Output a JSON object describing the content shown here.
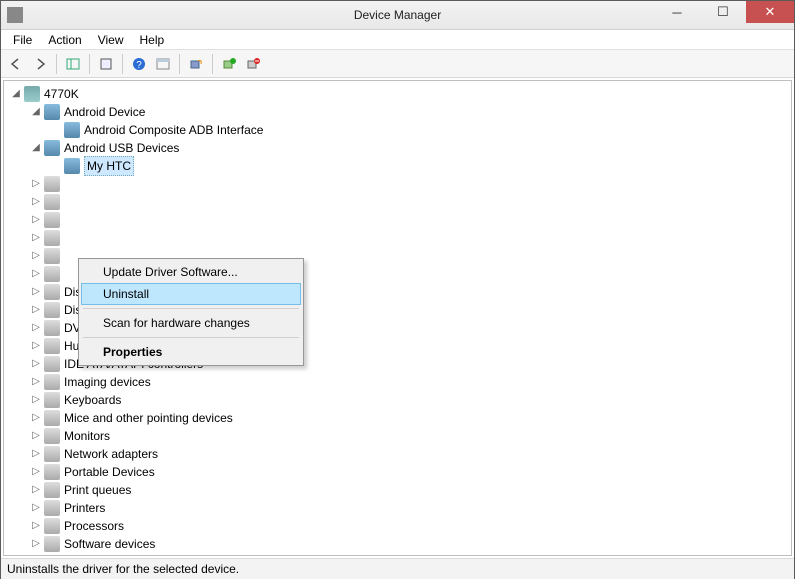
{
  "window": {
    "title": "Device Manager"
  },
  "menus": {
    "file": "File",
    "action": "Action",
    "view": "View",
    "help": "Help"
  },
  "toolbar_icons": {
    "back": "←",
    "forward": "→",
    "show_hide": "□",
    "properties": "□",
    "help": "?",
    "action_menu": "□",
    "scan": "⟳",
    "update": "+",
    "uninstall": "×"
  },
  "tree": {
    "root": "4770K",
    "android_device": "Android Device",
    "android_adb": "Android Composite ADB Interface",
    "android_usb": "Android USB Devices",
    "my_htc": "My HTC",
    "collapsed": [
      "Disk drives",
      "Display adapters",
      "DVD/CD-ROM drives",
      "Human Interface Devices",
      "IDE ATA/ATAPI controllers",
      "Imaging devices",
      "Keyboards",
      "Mice and other pointing devices",
      "Monitors",
      "Network adapters",
      "Portable Devices",
      "Print queues",
      "Printers",
      "Processors",
      "Software devices"
    ],
    "blank_collapsed_above": 4
  },
  "context_menu": {
    "update": "Update Driver Software...",
    "uninstall": "Uninstall",
    "scan": "Scan for hardware changes",
    "properties": "Properties"
  },
  "statusbar": {
    "text": "Uninstalls the driver for the selected device."
  }
}
